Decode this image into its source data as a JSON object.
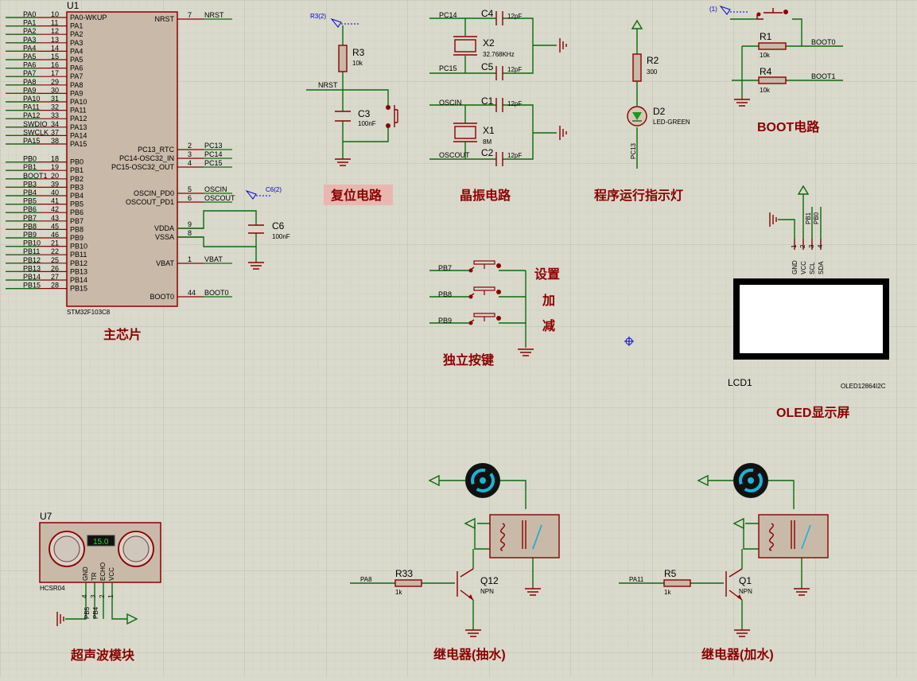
{
  "mcu": {
    "designator": "U1",
    "part": "STM32F103C8",
    "left_pins": [
      {
        "net": "PA0",
        "num": "10",
        "name": "PA0-WKUP"
      },
      {
        "net": "PA1",
        "num": "11",
        "name": "PA1"
      },
      {
        "net": "PA2",
        "num": "12",
        "name": "PA2"
      },
      {
        "net": "PA3",
        "num": "13",
        "name": "PA3"
      },
      {
        "net": "PA4",
        "num": "14",
        "name": "PA4"
      },
      {
        "net": "PA5",
        "num": "15",
        "name": "PA5"
      },
      {
        "net": "PA6",
        "num": "16",
        "name": "PA6"
      },
      {
        "net": "PA7",
        "num": "17",
        "name": "PA7"
      },
      {
        "net": "PA8",
        "num": "29",
        "name": "PA8"
      },
      {
        "net": "PA9",
        "num": "30",
        "name": "PA9"
      },
      {
        "net": "PA10",
        "num": "31",
        "name": "PA10"
      },
      {
        "net": "PA11",
        "num": "32",
        "name": "PA11"
      },
      {
        "net": "PA12",
        "num": "33",
        "name": "PA12"
      },
      {
        "net": "SWDIO",
        "num": "34",
        "name": "PA13"
      },
      {
        "net": "SWCLK",
        "num": "37",
        "name": "PA14"
      },
      {
        "net": "PA15",
        "num": "38",
        "name": "PA15"
      },
      {
        "net": "PB0",
        "num": "18",
        "name": "PB0"
      },
      {
        "net": "PB1",
        "num": "19",
        "name": "PB1"
      },
      {
        "net": "BOOT1",
        "num": "20",
        "name": "PB2"
      },
      {
        "net": "PB3",
        "num": "39",
        "name": "PB3"
      },
      {
        "net": "PB4",
        "num": "40",
        "name": "PB4"
      },
      {
        "net": "PB5",
        "num": "41",
        "name": "PB5"
      },
      {
        "net": "PB6",
        "num": "42",
        "name": "PB6"
      },
      {
        "net": "PB7",
        "num": "43",
        "name": "PB7"
      },
      {
        "net": "PB8",
        "num": "45",
        "name": "PB8"
      },
      {
        "net": "PB9",
        "num": "46",
        "name": "PB9"
      },
      {
        "net": "PB10",
        "num": "21",
        "name": "PB10"
      },
      {
        "net": "PB11",
        "num": "22",
        "name": "PB11"
      },
      {
        "net": "PB12",
        "num": "25",
        "name": "PB12"
      },
      {
        "net": "PB13",
        "num": "26",
        "name": "PB13"
      },
      {
        "net": "PB14",
        "num": "27",
        "name": "PB14"
      },
      {
        "net": "PB15",
        "num": "28",
        "name": "PB15"
      }
    ],
    "right_pins": [
      {
        "name": "NRST",
        "num": "7",
        "net": "NRST"
      },
      {
        "name": "PC13_RTC",
        "num": "2",
        "net": "PC13"
      },
      {
        "name": "PC14-OSC32_IN",
        "num": "3",
        "net": "PC14"
      },
      {
        "name": "PC15-OSC32_OUT",
        "num": "4",
        "net": "PC15"
      },
      {
        "name": "OSCIN_PD0",
        "num": "5",
        "net": "OSCIN"
      },
      {
        "name": "OSCOUT_PD1",
        "num": "6",
        "net": "OSCOUT"
      },
      {
        "name": "VDDA",
        "num": "9",
        "net": ""
      },
      {
        "name": "VSSA",
        "num": "8",
        "net": ""
      },
      {
        "name": "VBAT",
        "num": "1",
        "net": "VBAT"
      },
      {
        "name": "BOOT0",
        "num": "44",
        "net": "BOOT0"
      }
    ],
    "c6": {
      "name": "C6",
      "value": "100nF",
      "probe": "C6(2)"
    },
    "title": "主芯片"
  },
  "reset": {
    "r3": {
      "name": "R3",
      "value": "10k"
    },
    "c3": {
      "name": "C3",
      "value": "100nF"
    },
    "probe": "R3(2)",
    "net": "NRST",
    "title": "复位电路"
  },
  "crystal": {
    "c4": {
      "name": "C4",
      "value": "12pF"
    },
    "c5": {
      "name": "C5",
      "value": "12pF"
    },
    "x2": {
      "name": "X2",
      "value": "32.768KHz"
    },
    "c1": {
      "name": "C1",
      "value": "12pF"
    },
    "c2": {
      "name": "C2",
      "value": "12pF"
    },
    "x1": {
      "name": "X1",
      "value": "8M"
    },
    "nets": [
      "PC14",
      "PC15",
      "OSCIN",
      "OSCOUT"
    ],
    "title": "晶振电路"
  },
  "led": {
    "r2": {
      "name": "R2",
      "value": "300"
    },
    "d2": {
      "name": "D2",
      "value": "LED-GREEN"
    },
    "net": "PC13",
    "title": "程序运行指示灯"
  },
  "boot": {
    "probe": "(1)",
    "r1": {
      "name": "R1",
      "value": "10k"
    },
    "r4": {
      "name": "R4",
      "value": "10k"
    },
    "nets": [
      "BOOT0",
      "BOOT1"
    ],
    "title": "BOOT电路"
  },
  "oled": {
    "pins": [
      "GND",
      "VCC",
      "SCL",
      "SDA"
    ],
    "pin_nums": [
      "1",
      "2",
      "3",
      "4"
    ],
    "nets": [
      "PB1",
      "PB0"
    ],
    "designator": "LCD1",
    "part": "OLED12864I2C",
    "title": "OLED显示屏"
  },
  "keys": {
    "nets": [
      "PB7",
      "PB8",
      "PB9"
    ],
    "labels": [
      "设置",
      "加",
      "减"
    ],
    "title": "独立按键"
  },
  "ultrasonic": {
    "designator": "U7",
    "part": "HCSR04",
    "display": "15.0",
    "pins": [
      "GND",
      "TR",
      "ECHO",
      "VCC"
    ],
    "pin_nums": [
      "4",
      "3",
      "2",
      "1"
    ],
    "nets": [
      "PB5",
      "PB4"
    ],
    "title": "超声波模块"
  },
  "relay_pump": {
    "net": "PA8",
    "resistor": {
      "name": "R33",
      "value": "1k"
    },
    "transistor": {
      "name": "Q12",
      "value": "NPN"
    },
    "title": "继电器(抽水)"
  },
  "relay_fill": {
    "net": "PA11",
    "resistor": {
      "name": "R5",
      "value": "1k"
    },
    "transistor": {
      "name": "Q1",
      "value": "NPN"
    },
    "title": "继电器(加水)"
  },
  "colors": {
    "wire": "#0b6b0b",
    "component": "#8b0000",
    "title": "#8b0000",
    "probe": "#0000cc",
    "background": "#d9d9cc"
  }
}
